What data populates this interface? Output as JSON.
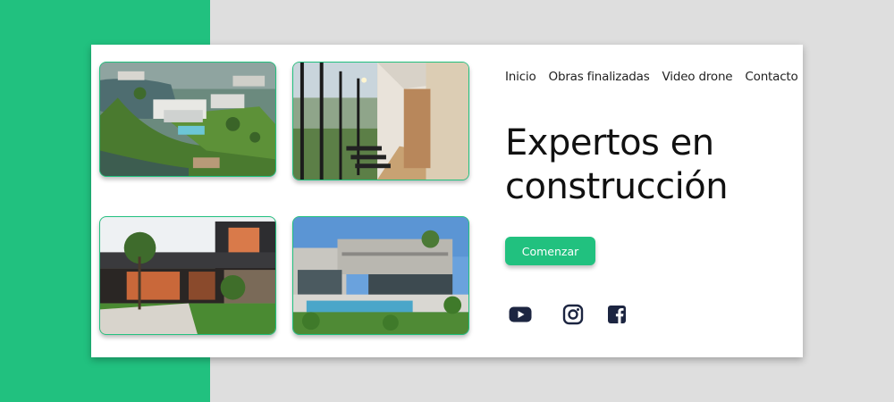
{
  "nav": {
    "items": [
      "Inicio",
      "Obras finalizadas",
      "Video drone",
      "Contacto"
    ]
  },
  "hero": {
    "headline_line1": "Expertos en",
    "headline_line2": "construcción",
    "cta_label": "Comenzar"
  },
  "social": {
    "icons": [
      "youtube-icon",
      "instagram-icon",
      "facebook-icon"
    ]
  },
  "colors": {
    "accent": "#21c17f",
    "background": "#dedede",
    "card": "#ffffff",
    "icon": "#1c2541"
  }
}
